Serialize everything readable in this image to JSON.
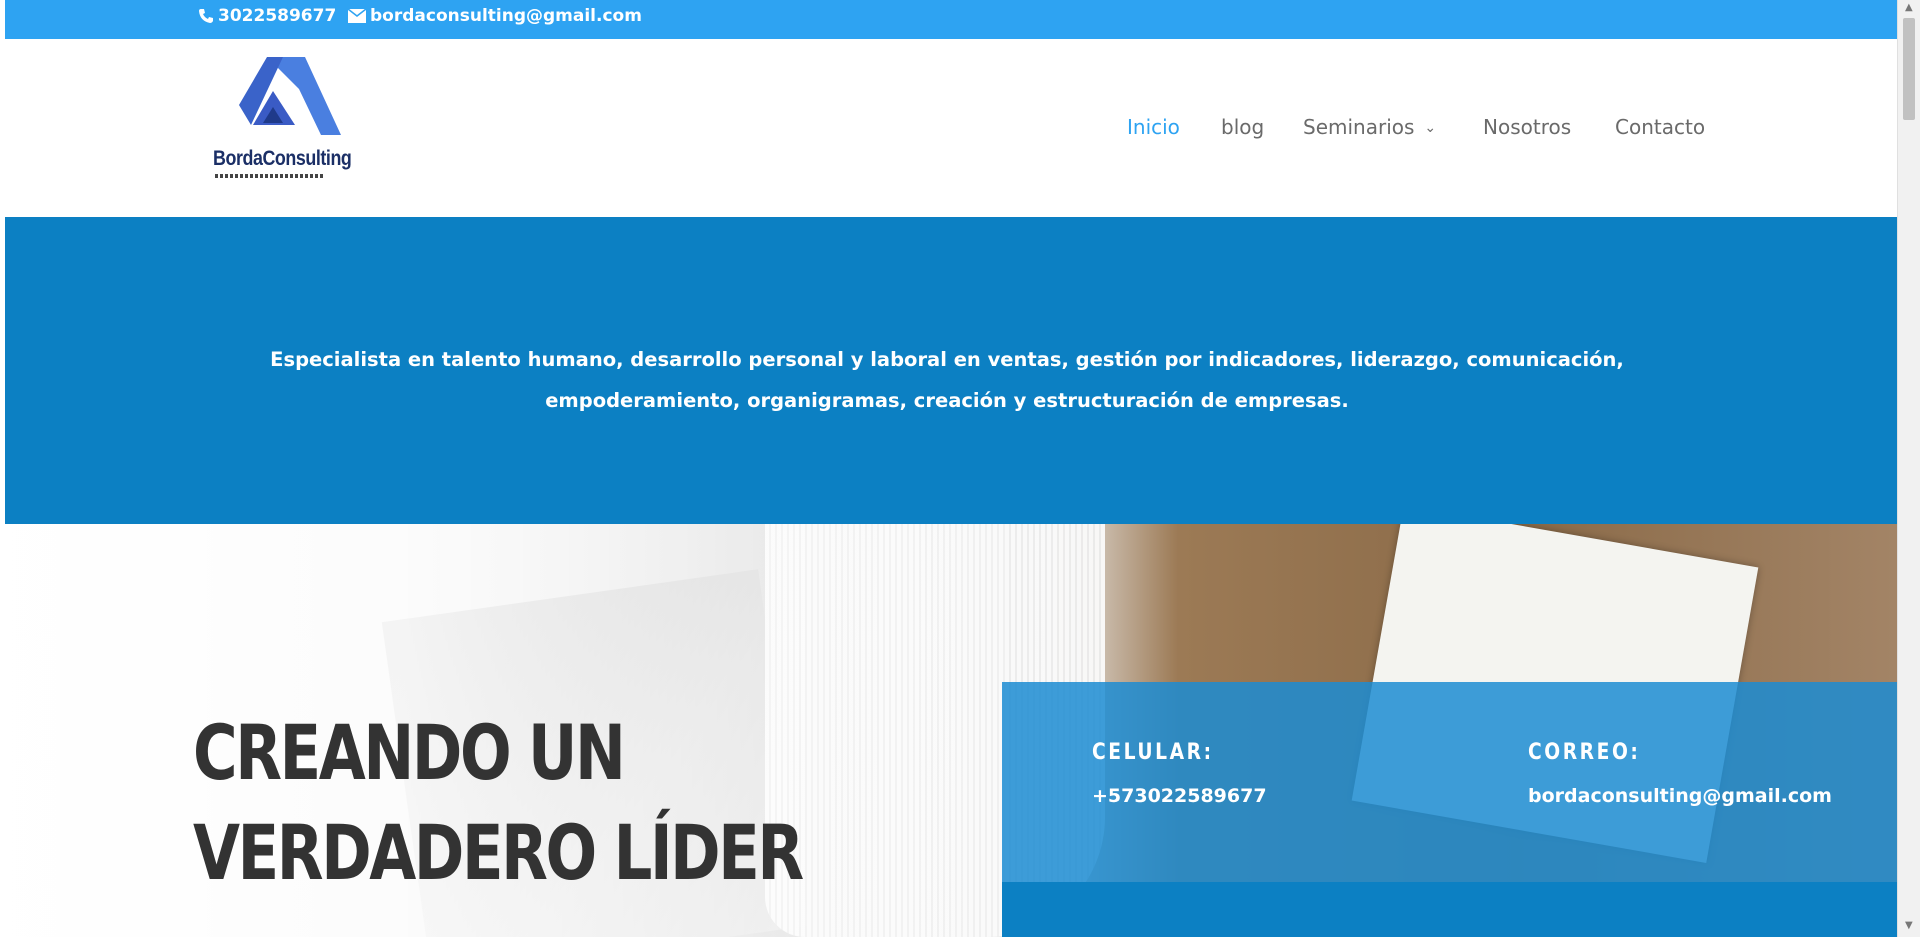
{
  "topbar": {
    "phone": "3022589677",
    "email": "bordaconsulting@gmail.com"
  },
  "logo": {
    "name": "BordaConsulting"
  },
  "nav": {
    "items": [
      {
        "label": "Inicio",
        "active": true
      },
      {
        "label": "blog"
      },
      {
        "label": "Seminarios",
        "has_dropdown": true
      },
      {
        "label": "Nosotros"
      },
      {
        "label": "Contacto"
      }
    ],
    "dropdown_icon": "chevron-down-icon"
  },
  "band": {
    "text": "Especialista en talento humano, desarrollo personal y laboral en ventas, gestión por indicadores, liderazgo, comunicación, empoderamiento, organigramas, creación y estructuración de empresas."
  },
  "hero": {
    "line1": "CREANDO UN",
    "line2": "VERDADERO LÍDER"
  },
  "info": {
    "cel_label": "CELULAR:",
    "cel_value": "+573022589677",
    "mail_label": "CORREO:",
    "mail_value": "bordaconsulting@gmail.com"
  },
  "colors": {
    "accent": "#2ea3f2",
    "band": "#0c80c3",
    "heading": "#333333"
  }
}
